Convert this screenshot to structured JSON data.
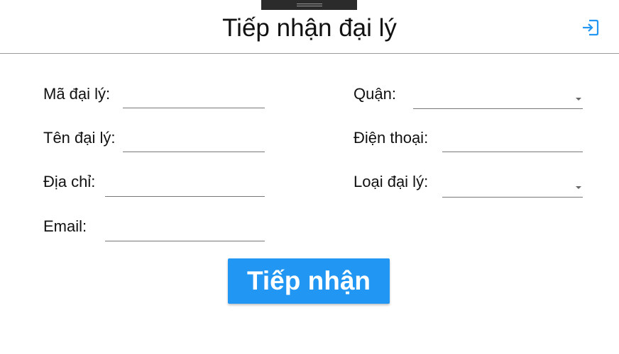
{
  "header": {
    "title": "Tiếp nhận đại lý",
    "exit_icon": "exit-icon",
    "accent_color": "#2196f3"
  },
  "form": {
    "ma_dai_ly": {
      "label": "Mã đại lý:",
      "value": ""
    },
    "ten_dai_ly": {
      "label": "Tên đại lý:",
      "value": ""
    },
    "dia_chi": {
      "label": "Địa chỉ:",
      "value": ""
    },
    "email": {
      "label": "Email:",
      "value": ""
    },
    "quan": {
      "label": "Quận:",
      "selected": ""
    },
    "dien_thoai": {
      "label": "Điện thoại:",
      "value": ""
    },
    "loai_dai_ly": {
      "label": "Loại đại lý:",
      "selected": ""
    }
  },
  "actions": {
    "submit_label": "Tiếp nhận"
  }
}
